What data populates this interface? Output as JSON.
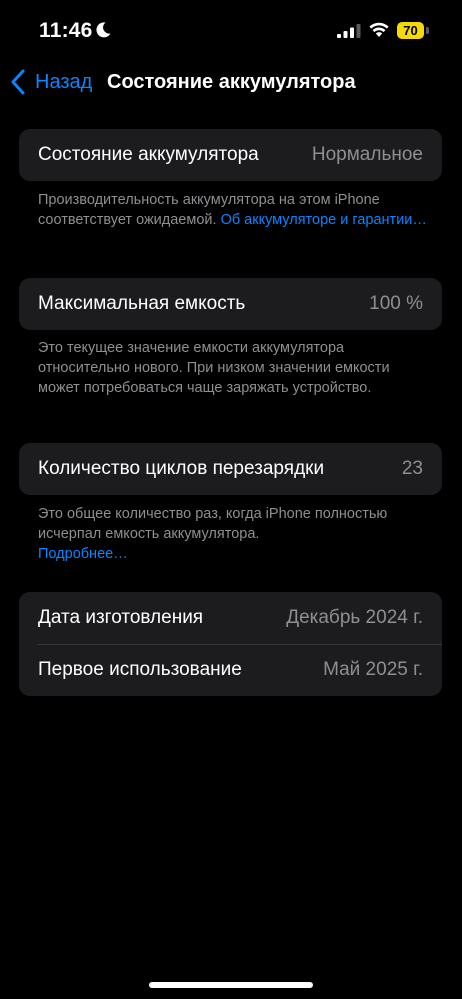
{
  "status_bar": {
    "time": "11:46",
    "battery_level": "70",
    "battery_color": "#f5d90a"
  },
  "nav": {
    "back_label": "Назад",
    "title": "Состояние аккумулятора"
  },
  "health": {
    "label": "Состояние аккумулятора",
    "value": "Нормальное",
    "footnote_text": "Производительность аккумулятора на этом iPhone соответствует ожидаемой. ",
    "footnote_link": "Об аккумуляторе и гарантии…"
  },
  "capacity": {
    "label": "Максимальная емкость",
    "value": "100 %",
    "footnote_text": "Это текущее значение емкости аккумулятора относительно нового. При низком значении емкости может потребоваться чаще заряжать устройство."
  },
  "cycles": {
    "label": "Количество циклов перезарядки",
    "value": "23",
    "footnote_text": "Это общее количество раз, когда iPhone полностью исчерпал емкость аккумулятора.",
    "footnote_link": "Подробнее…"
  },
  "dates": {
    "manufacture_label": "Дата изготовления",
    "manufacture_value": "Декабрь 2024 г.",
    "first_use_label": "Первое использование",
    "first_use_value": "Май 2025 г."
  },
  "colors": {
    "accent": "#0a84ff",
    "group_background": "#1c1c1e",
    "secondary_text": "#8e8e93"
  }
}
